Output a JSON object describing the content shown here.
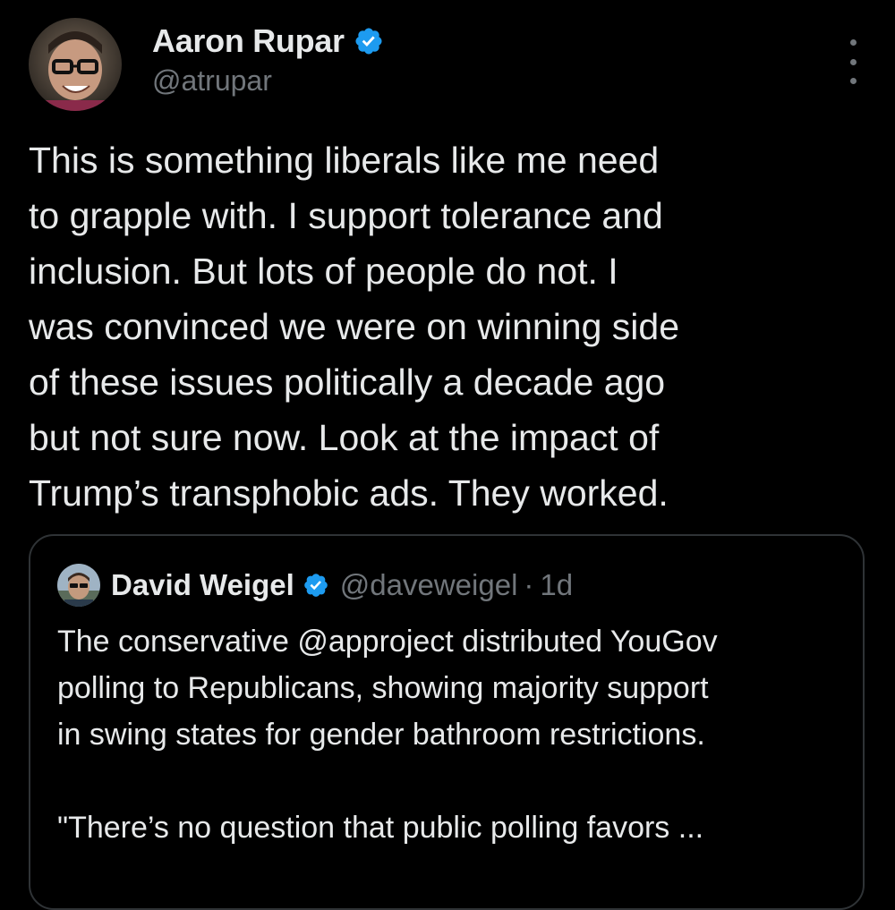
{
  "tweet": {
    "author": {
      "display_name": "Aaron Rupar",
      "handle": "@atrupar",
      "verified": true
    },
    "more_icon": "more-vertical-icon",
    "text": "This is something liberals like me need\nto grapple with. I support tolerance and\ninclusion. But lots of people do not. I\nwas convinced we were on winning side\nof these issues politically a decade ago\nbut not sure now. Look at the impact of\nTrump’s transphobic ads. They worked."
  },
  "quoted_tweet": {
    "author": {
      "display_name": "David Weigel",
      "handle": "@daveweigel",
      "verified": true
    },
    "separator": "·",
    "time": "1d",
    "text": "The conservative @approject distributed YouGov\npolling to Republicans, showing majority support\nin swing states for gender bathroom restrictions.\n\n\"There’s no question that public polling favors ..."
  },
  "colors": {
    "background": "#000000",
    "text_primary": "#e7e9ea",
    "text_secondary": "#71767b",
    "verified_badge": "#1d9bf0",
    "border": "#2f3336"
  }
}
